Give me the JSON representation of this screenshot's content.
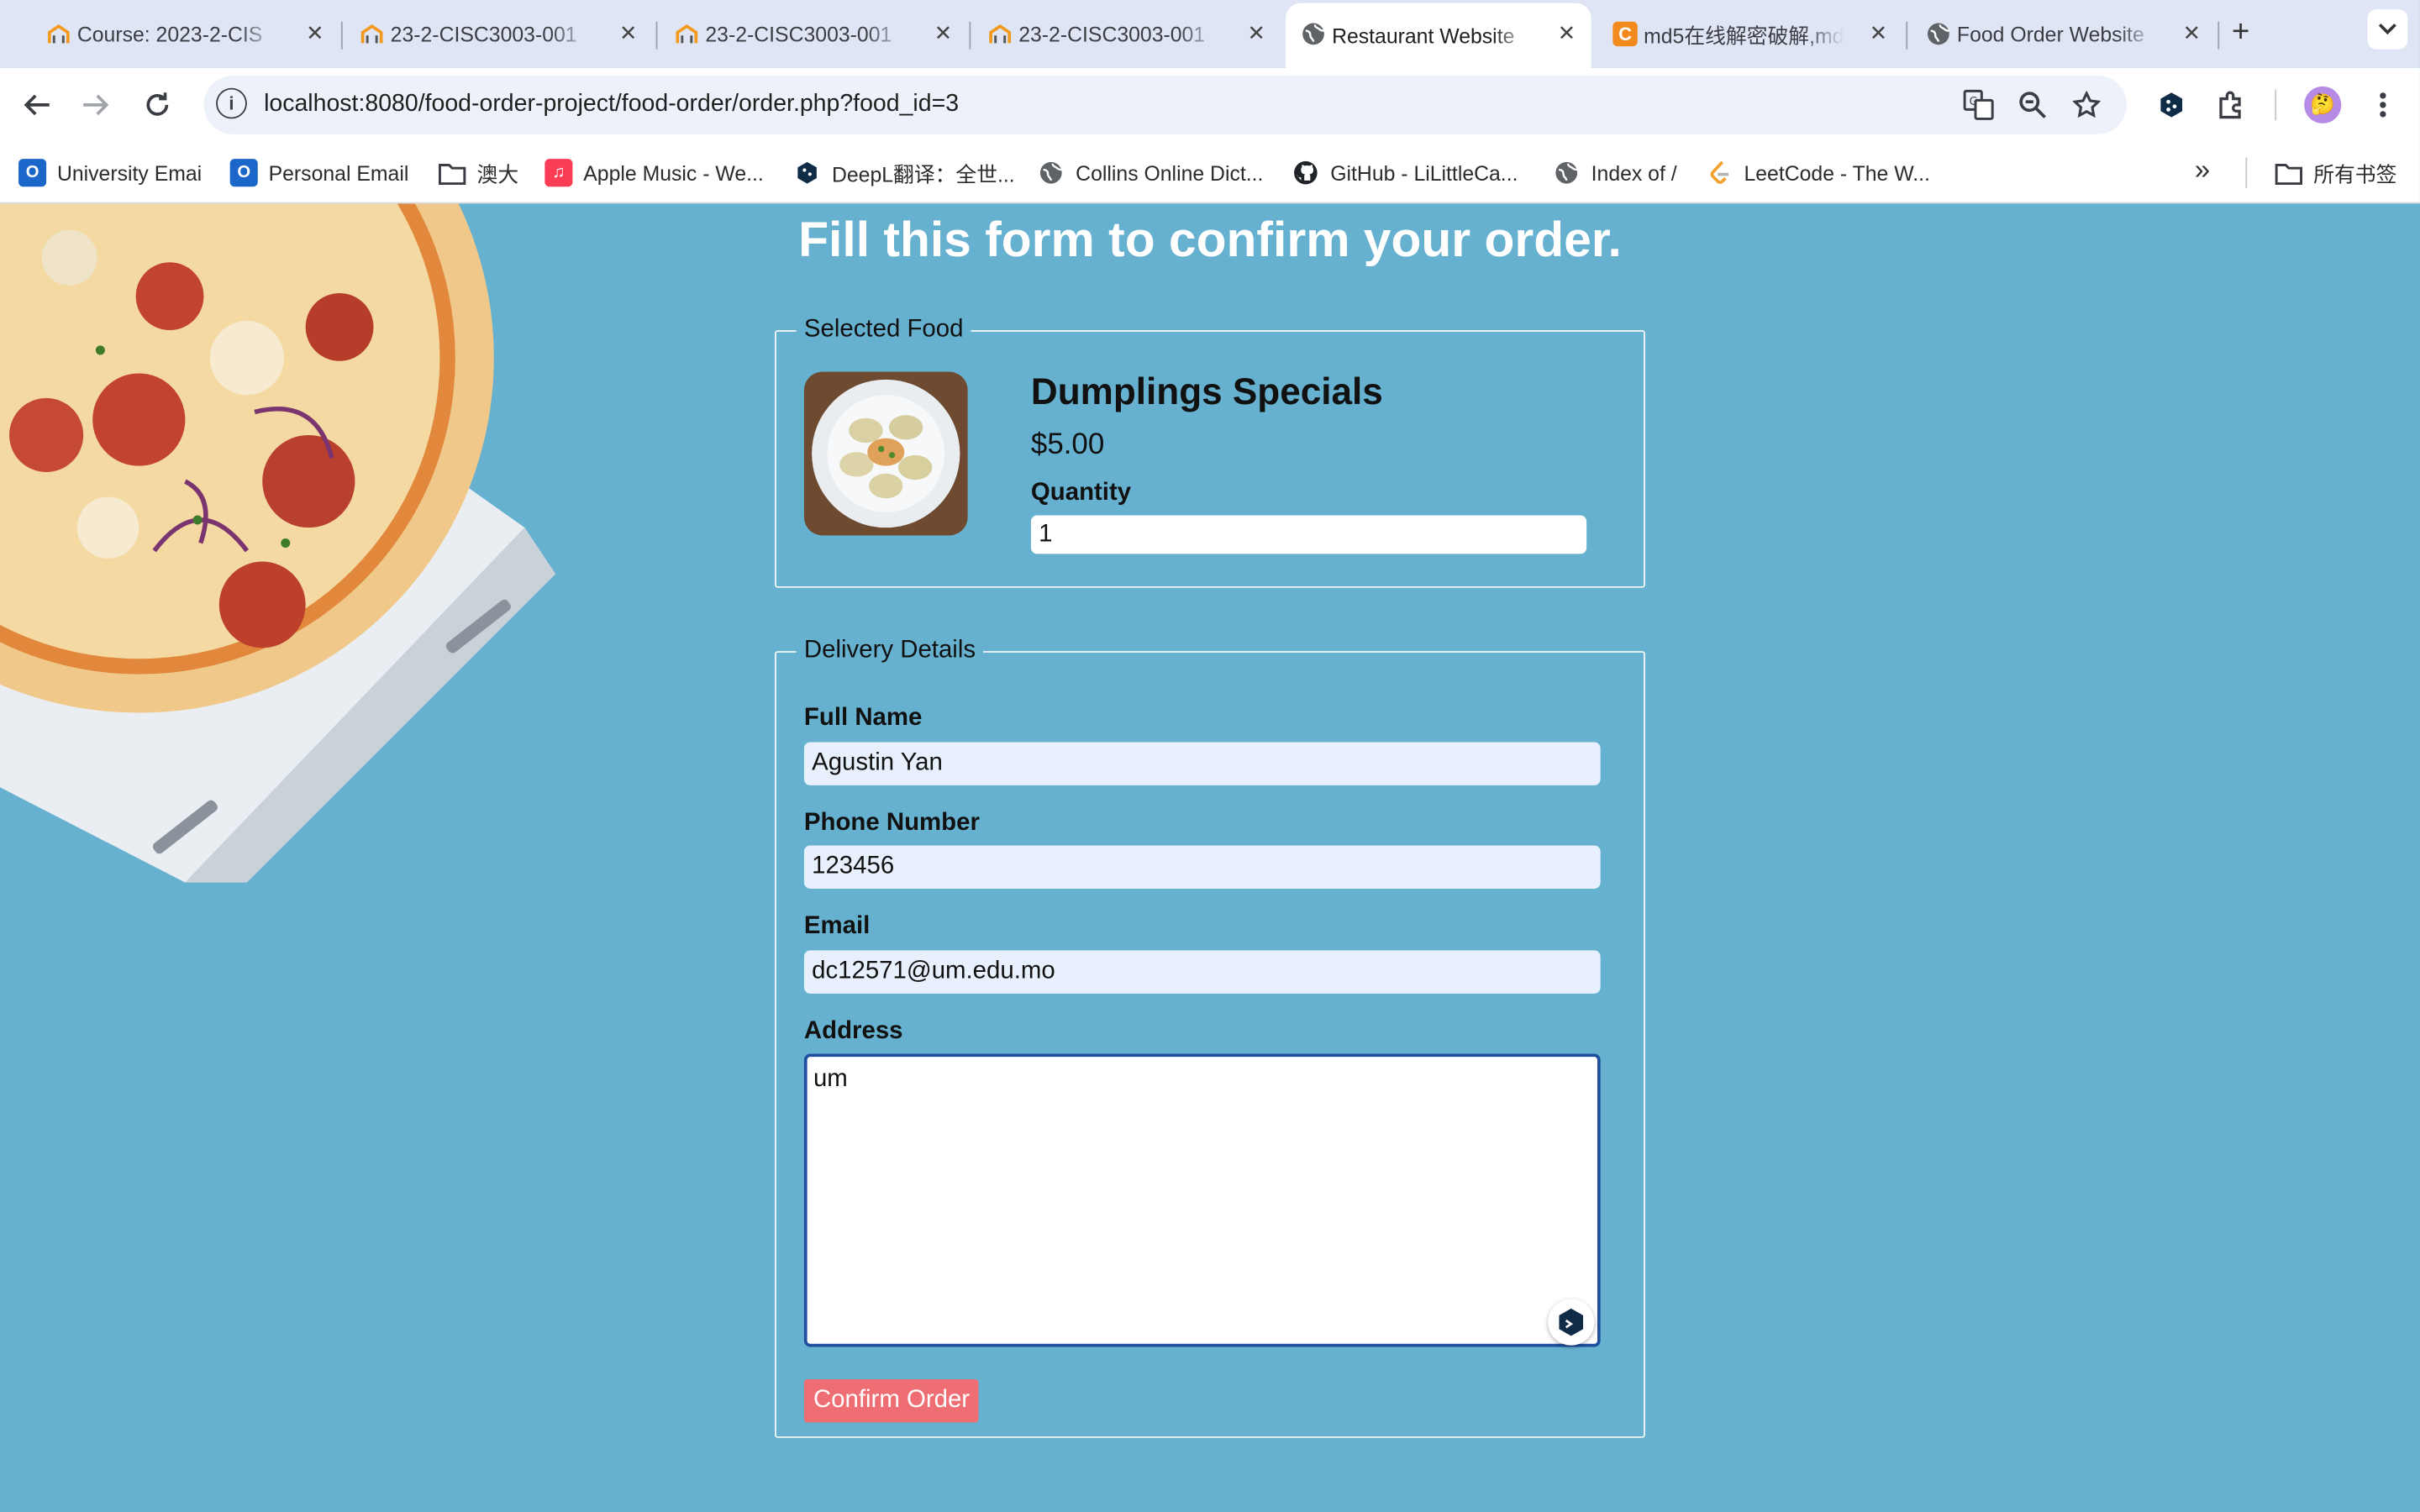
{
  "browser": {
    "tabs": [
      {
        "title": "Course: 2023-2-CIS",
        "icon": "moodle-icon",
        "active": false
      },
      {
        "title": "23-2-CISC3003-001",
        "icon": "moodle-icon",
        "active": false
      },
      {
        "title": "23-2-CISC3003-001",
        "icon": "moodle-icon",
        "active": false
      },
      {
        "title": "23-2-CISC3003-001",
        "icon": "moodle-icon",
        "active": false
      },
      {
        "title": "Restaurant Website",
        "icon": "globe-icon",
        "active": true
      },
      {
        "title": "md5在线解密破解,md5",
        "icon": "cmd5-icon",
        "active": false
      },
      {
        "title": "Food Order Website",
        "icon": "globe-icon",
        "active": false
      }
    ],
    "url_host": "localhost",
    "url_rest": ":8080/food-order-project/food-order/order.php?food_id=3",
    "bookmarks": [
      {
        "label": "University Emai",
        "icon": "outlook-icon"
      },
      {
        "label": "Personal Email",
        "icon": "outlook-icon"
      },
      {
        "label": "澳大",
        "icon": "folder-icon"
      },
      {
        "label": "Apple Music - We...",
        "icon": "apple-music-icon"
      },
      {
        "label": "DeepL翻译：全世...",
        "icon": "deepl-icon"
      },
      {
        "label": "Collins Online Dict...",
        "icon": "globe-icon"
      },
      {
        "label": "GitHub - LiLittleCa...",
        "icon": "github-icon"
      },
      {
        "label": "Index of /",
        "icon": "globe-icon"
      },
      {
        "label": "LeetCode - The W...",
        "icon": "leetcode-icon"
      }
    ],
    "all_bookmarks": "所有书签",
    "colors": {
      "tabstrip": "#dfe5f5",
      "page_bg": "#66b1cf",
      "confirm": "#ee6e73"
    }
  },
  "page": {
    "heading": "Fill this form to confirm your order.",
    "selected_food": {
      "legend": "Selected Food",
      "name": "Dumplings Specials",
      "price": "$5.00",
      "quantity_label": "Quantity",
      "quantity_value": "1"
    },
    "delivery": {
      "legend": "Delivery Details",
      "full_name_label": "Full Name",
      "full_name_value": "Agustin Yan",
      "phone_label": "Phone Number",
      "phone_value": "123456",
      "email_label": "Email",
      "email_value": "dc12571@um.edu.mo",
      "address_label": "Address",
      "address_value": "um",
      "confirm_label": "Confirm Order"
    }
  }
}
